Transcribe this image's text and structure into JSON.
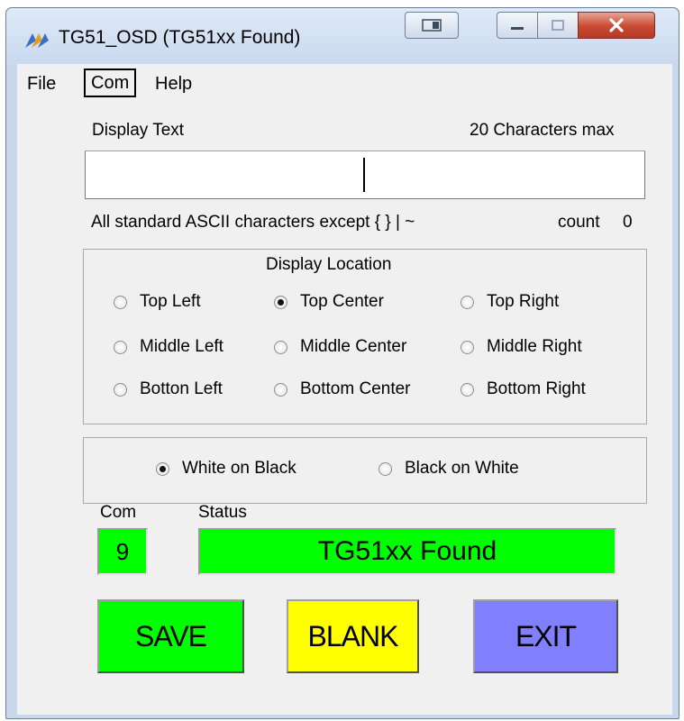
{
  "window": {
    "title": "TG51_OSD (TG51xx Found)"
  },
  "menu": {
    "file": "File",
    "com": "Com",
    "help": "Help"
  },
  "display_text": {
    "label": "Display Text",
    "max_label": "20 Characters max",
    "value": "",
    "hint": "All standard ASCII characters except { } | ~",
    "count_label": "count",
    "count_value": "0"
  },
  "location": {
    "title": "Display Location",
    "options": [
      {
        "label": "Top Left",
        "selected": false
      },
      {
        "label": "Top Center",
        "selected": true
      },
      {
        "label": "Top Right",
        "selected": false
      },
      {
        "label": "Middle Left",
        "selected": false
      },
      {
        "label": "Middle Center",
        "selected": false
      },
      {
        "label": "Middle Right",
        "selected": false
      },
      {
        "label": "Botton Left",
        "selected": false
      },
      {
        "label": "Bottom Center",
        "selected": false
      },
      {
        "label": "Bottom Right",
        "selected": false
      }
    ]
  },
  "color_mode": {
    "options": [
      {
        "label": "White on Black",
        "selected": true
      },
      {
        "label": "Black on White",
        "selected": false
      }
    ]
  },
  "com": {
    "label": "Com",
    "value": "9"
  },
  "status": {
    "label": "Status",
    "value": "TG51xx Found"
  },
  "buttons": {
    "save": "SAVE",
    "blank": "BLANK",
    "exit": "EXIT"
  },
  "colors": {
    "save": "#00ff00",
    "blank": "#ffff00",
    "exit": "#8080ff",
    "status": "#00ff00"
  }
}
